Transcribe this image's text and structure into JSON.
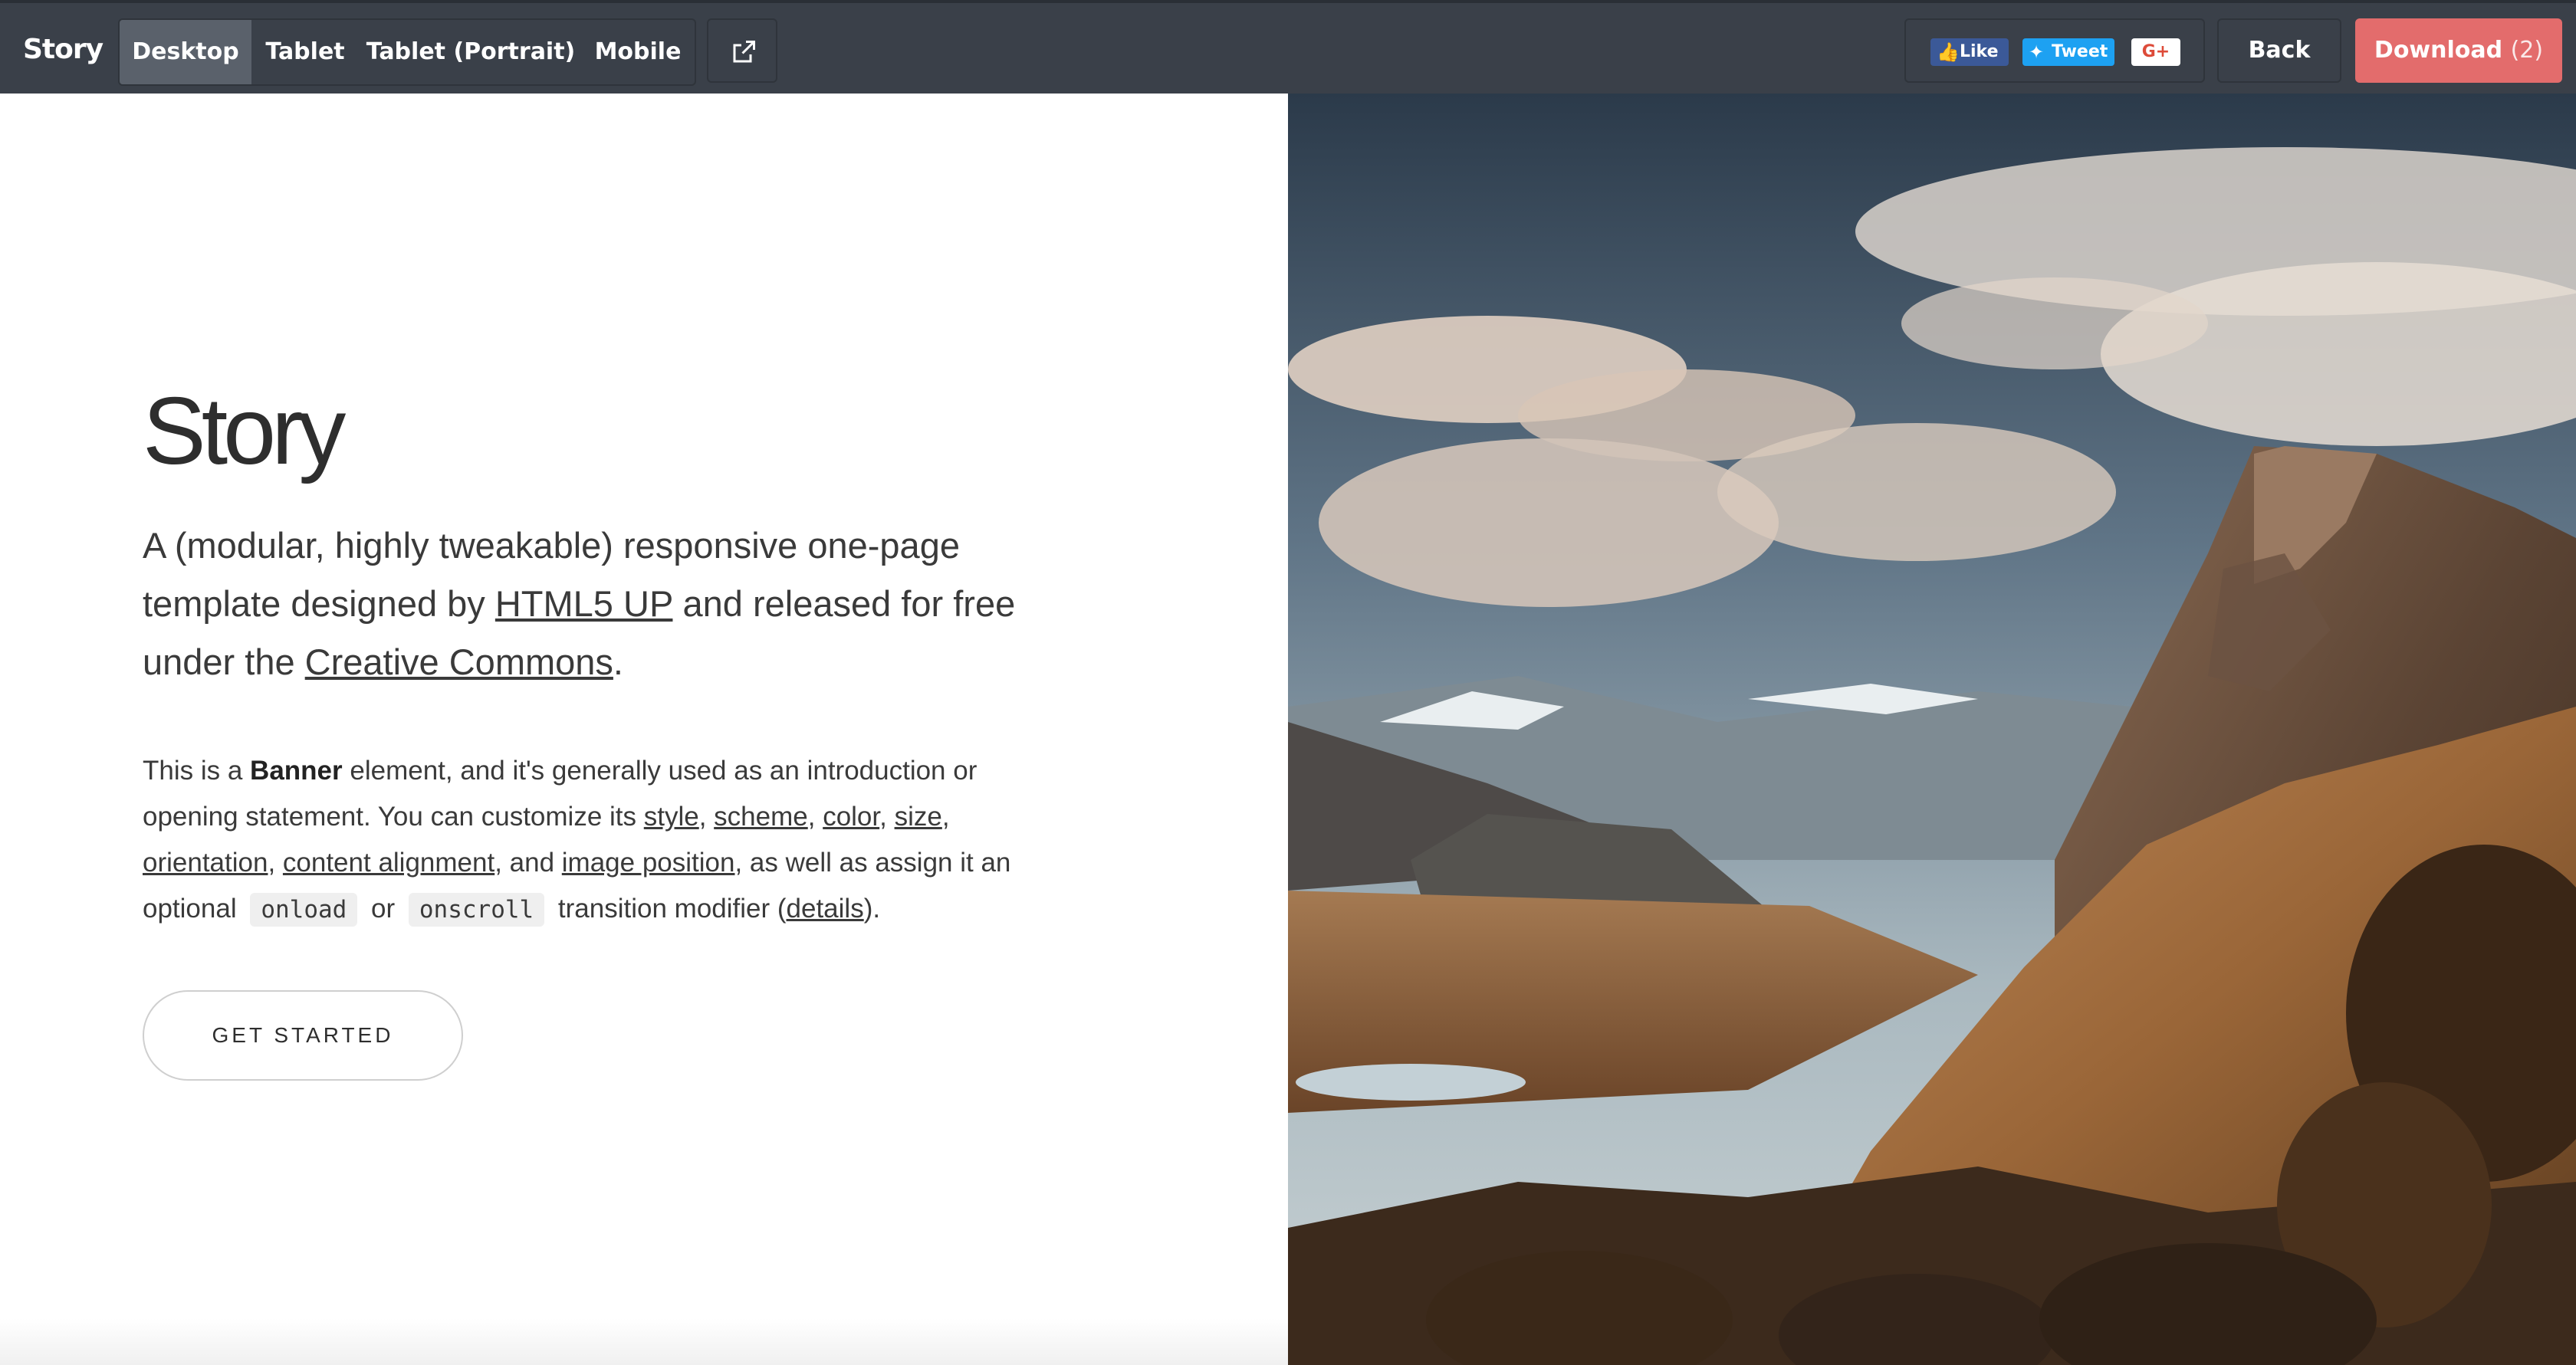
{
  "topbar": {
    "brand": "Story",
    "view_tabs": [
      {
        "label": "Desktop",
        "active": true
      },
      {
        "label": "Tablet",
        "active": false
      },
      {
        "label": "Tablet (Portrait)",
        "active": false
      },
      {
        "label": "Mobile",
        "active": false
      }
    ],
    "external_icon": "external-link-icon",
    "social": {
      "facebook_label": "Like",
      "twitter_label": "Tweet",
      "google_label": "G+"
    },
    "back_label": "Back",
    "download_label": "Download",
    "download_count": "(2)"
  },
  "banner": {
    "title": "Story",
    "lead_part1": "A (modular, highly tweakable) responsive one-page template designed by ",
    "lead_link1": "HTML5 UP",
    "lead_part2": " and released for free under the ",
    "lead_link2": "Creative Commons",
    "lead_part3": ".",
    "body_t1": "This is a ",
    "body_bold": "Banner",
    "body_t2": " element, and it's generally used as an introduction or opening statement. You can customize its ",
    "link_style": "style",
    "sep1": ", ",
    "link_scheme": "scheme",
    "sep2": ", ",
    "link_color": "color",
    "sep3": ", ",
    "link_size": "size",
    "sep4": ", ",
    "link_orientation": "orientation",
    "sep5": ", ",
    "link_content_alignment": "content alignment",
    "body_t3": ", and ",
    "link_image_position": "image position",
    "body_t4": ", as well as assign it an optional ",
    "code_onload": "onload",
    "body_t5": " or ",
    "code_onscroll": "onscroll",
    "body_t6": " transition modifier (",
    "link_details": "details",
    "body_t7": ").",
    "cta_label": "GET STARTED"
  },
  "colors": {
    "topbar_bg": "#3a4049",
    "download_bg": "#e36c6c",
    "facebook": "#3b5998",
    "twitter": "#1da1f2",
    "google": "#dd4b39"
  }
}
